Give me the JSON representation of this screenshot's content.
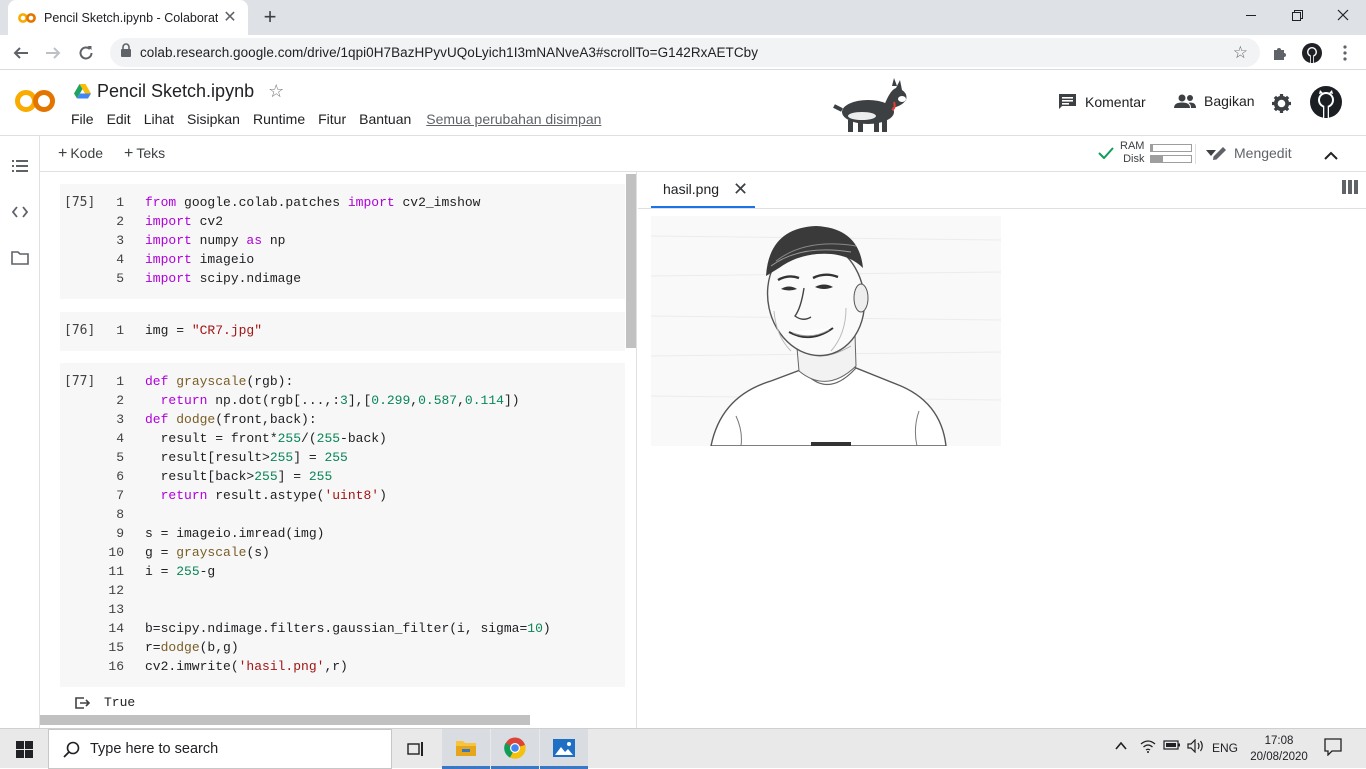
{
  "browser": {
    "tab_title": "Pencil Sketch.ipynb - Colaborato",
    "url": "colab.research.google.com/drive/1qpi0H7BazHPyvUQoLyich1I3mNANveA3#scrollTo=G142RxAETCby"
  },
  "colab": {
    "logo_text": "CO",
    "doc_title": "Pencil Sketch.ipynb",
    "menu": [
      "File",
      "Edit",
      "Lihat",
      "Sisipkan",
      "Runtime",
      "Fitur",
      "Bantuan"
    ],
    "saved_status": "Semua perubahan disimpan",
    "comment_label": "Komentar",
    "share_label": "Bagikan"
  },
  "toolbar": {
    "add_code": "Kode",
    "add_text": "Teks",
    "ram_label": "RAM",
    "disk_label": "Disk",
    "ram_usage": 0.05,
    "disk_usage": 0.3,
    "editing_label": "Mengedit"
  },
  "cells": [
    {
      "exec": "[75]",
      "lines": [
        {
          "n": "1",
          "code": "from google.colab.patches import cv2_imshow"
        },
        {
          "n": "2",
          "code": "import cv2"
        },
        {
          "n": "3",
          "code": "import numpy as np"
        },
        {
          "n": "4",
          "code": "import imageio"
        },
        {
          "n": "5",
          "code": "import scipy.ndimage"
        }
      ]
    },
    {
      "exec": "[76]",
      "lines": [
        {
          "n": "1",
          "code": "img = \"CR7.jpg\""
        }
      ]
    },
    {
      "exec": "[77]",
      "lines": [
        {
          "n": "1",
          "code": "def grayscale(rgb):"
        },
        {
          "n": "2",
          "code": "  return np.dot(rgb[...,:3],[0.299,0.587,0.114])"
        },
        {
          "n": "3",
          "code": "def dodge(front,back):"
        },
        {
          "n": "4",
          "code": "  result = front*255/(255-back)"
        },
        {
          "n": "5",
          "code": "  result[result>255] = 255"
        },
        {
          "n": "6",
          "code": "  result[back>255] = 255"
        },
        {
          "n": "7",
          "code": "  return result.astype('uint8')"
        },
        {
          "n": "8",
          "code": ""
        },
        {
          "n": "9",
          "code": "s = imageio.imread(img)"
        },
        {
          "n": "10",
          "code": "g = grayscale(s)"
        },
        {
          "n": "11",
          "code": "i = 255-g"
        },
        {
          "n": "12",
          "code": ""
        },
        {
          "n": "13",
          "code": ""
        },
        {
          "n": "14",
          "code": "b=scipy.ndimage.filters.gaussian_filter(i, sigma=10)"
        },
        {
          "n": "15",
          "code": "r=dodge(b,g)"
        },
        {
          "n": "16",
          "code": "cv2.imwrite('hasil.png',r)"
        }
      ]
    }
  ],
  "output": {
    "text": "True"
  },
  "image_pane": {
    "tab_label": "hasil.png"
  },
  "taskbar": {
    "search_placeholder": "Type here to search",
    "language": "ENG",
    "time": "17:08",
    "date": "20/08/2020"
  }
}
